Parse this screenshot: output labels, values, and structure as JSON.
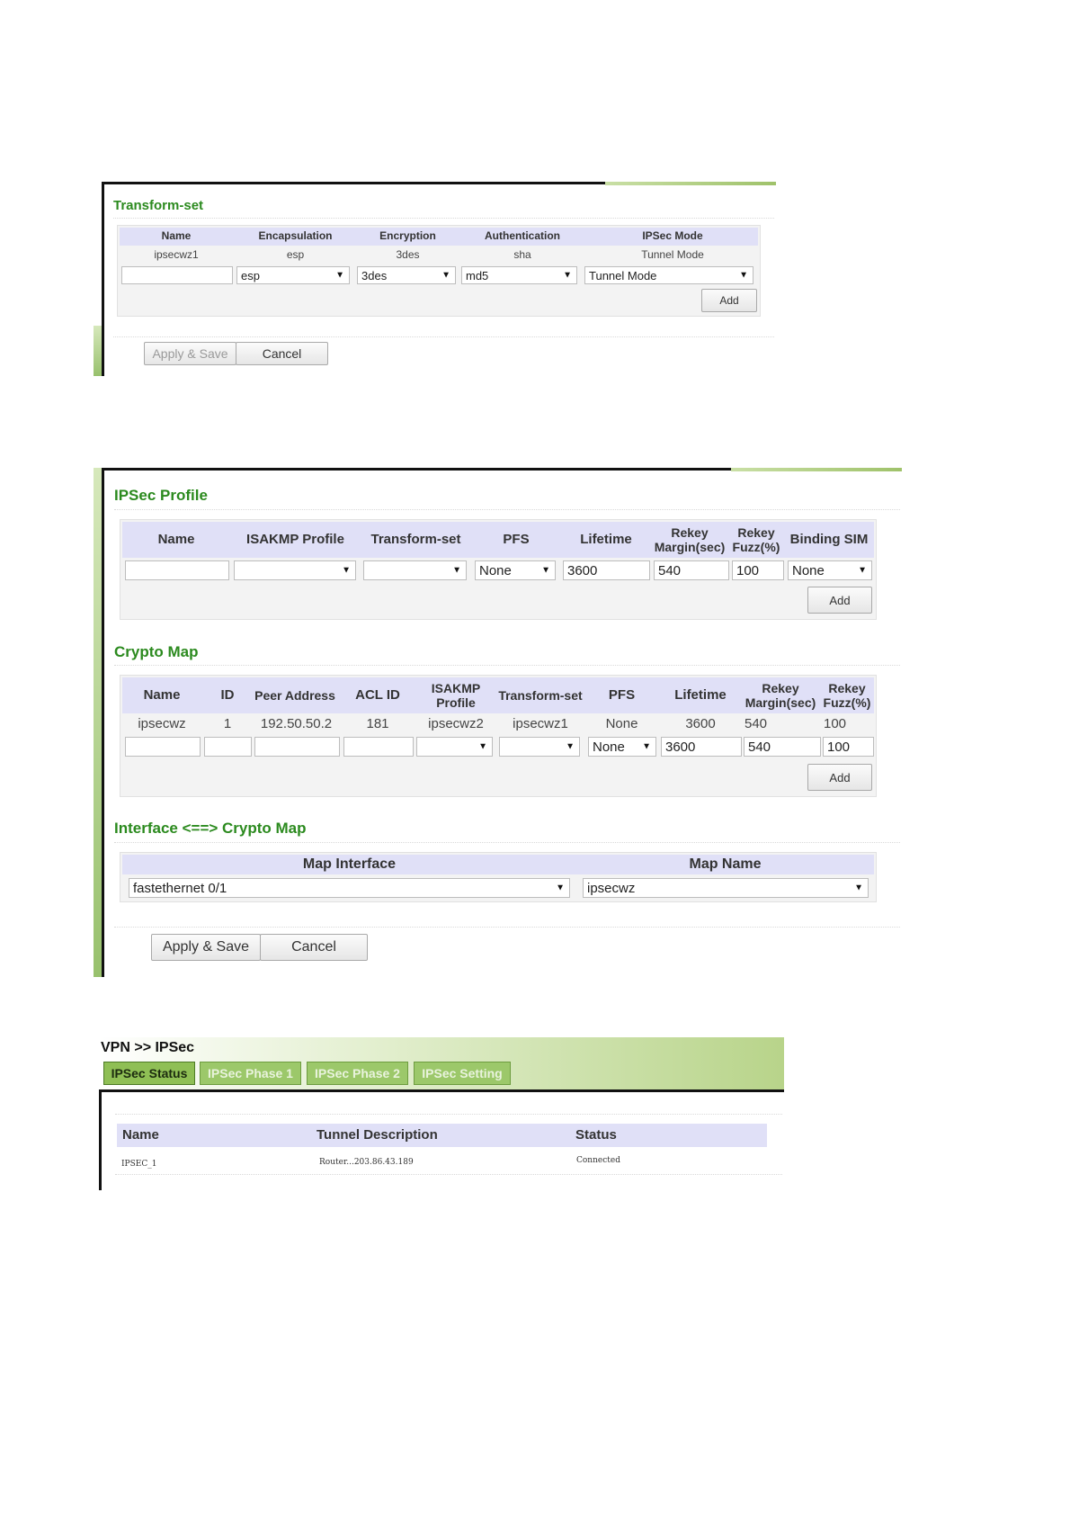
{
  "transform_set": {
    "title": "Transform-set",
    "headers": [
      "Name",
      "Encapsulation",
      "Encryption",
      "Authentication",
      "IPSec Mode"
    ],
    "row": [
      "ipsecwz1",
      "esp",
      "3des",
      "sha",
      "Tunnel Mode"
    ],
    "inputs": {
      "name": "",
      "encapsulation": "esp",
      "encryption": "3des",
      "authentication": "md5",
      "mode": "Tunnel Mode"
    },
    "add_label": "Add",
    "apply_label": "Apply & Save",
    "cancel_label": "Cancel"
  },
  "ipsec_profile": {
    "title": "IPSec Profile",
    "headers": [
      "Name",
      "ISAKMP Profile",
      "Transform-set",
      "PFS",
      "Lifetime",
      "Rekey Margin(sec)",
      "Rekey Fuzz(%)",
      "Binding SIM"
    ],
    "inputs": {
      "name": "",
      "isakmp": "",
      "transform": "",
      "pfs": "None",
      "lifetime": "3600",
      "margin": "540",
      "fuzz": "100",
      "sim": "None"
    },
    "add_label": "Add"
  },
  "crypto_map": {
    "title": "Crypto Map",
    "headers": [
      "Name",
      "ID",
      "Peer Address",
      "ACL ID",
      "ISAKMP Profile",
      "Transform-set",
      "PFS",
      "Lifetime",
      "Rekey Margin(sec)",
      "Rekey Fuzz(%)"
    ],
    "row": [
      "ipsecwz",
      "1",
      "192.50.50.2",
      "181",
      "ipsecwz2",
      "ipsecwz1",
      "None",
      "3600",
      "540",
      "100"
    ],
    "inputs": {
      "name": "",
      "id": "",
      "peer": "",
      "acl": "",
      "isakmp": "",
      "transform": "",
      "pfs": "None",
      "lifetime": "3600",
      "margin": "540",
      "fuzz": "100"
    },
    "add_label": "Add"
  },
  "interface_map": {
    "title": "Interface <==> Crypto Map",
    "headers": [
      "Map Interface",
      "Map Name"
    ],
    "inputs": {
      "interface": "fastethernet 0/1",
      "map_name": "ipsecwz"
    },
    "apply_label": "Apply & Save",
    "cancel_label": "Cancel"
  },
  "vpn": {
    "breadcrumb": "VPN >> IPSec",
    "tabs": [
      "IPSec Status",
      "IPSec Phase 1",
      "IPSec Phase 2",
      "IPSec Setting"
    ],
    "headers": [
      "Name",
      "Tunnel Description",
      "Status"
    ],
    "row": [
      "IPSEC_1",
      "Router...203.86.43.189",
      "Connected"
    ]
  },
  "colors": {
    "section_title": "#2b8a1e",
    "table_header": "#e0e0f7",
    "accent_green": "#9fc26a"
  }
}
